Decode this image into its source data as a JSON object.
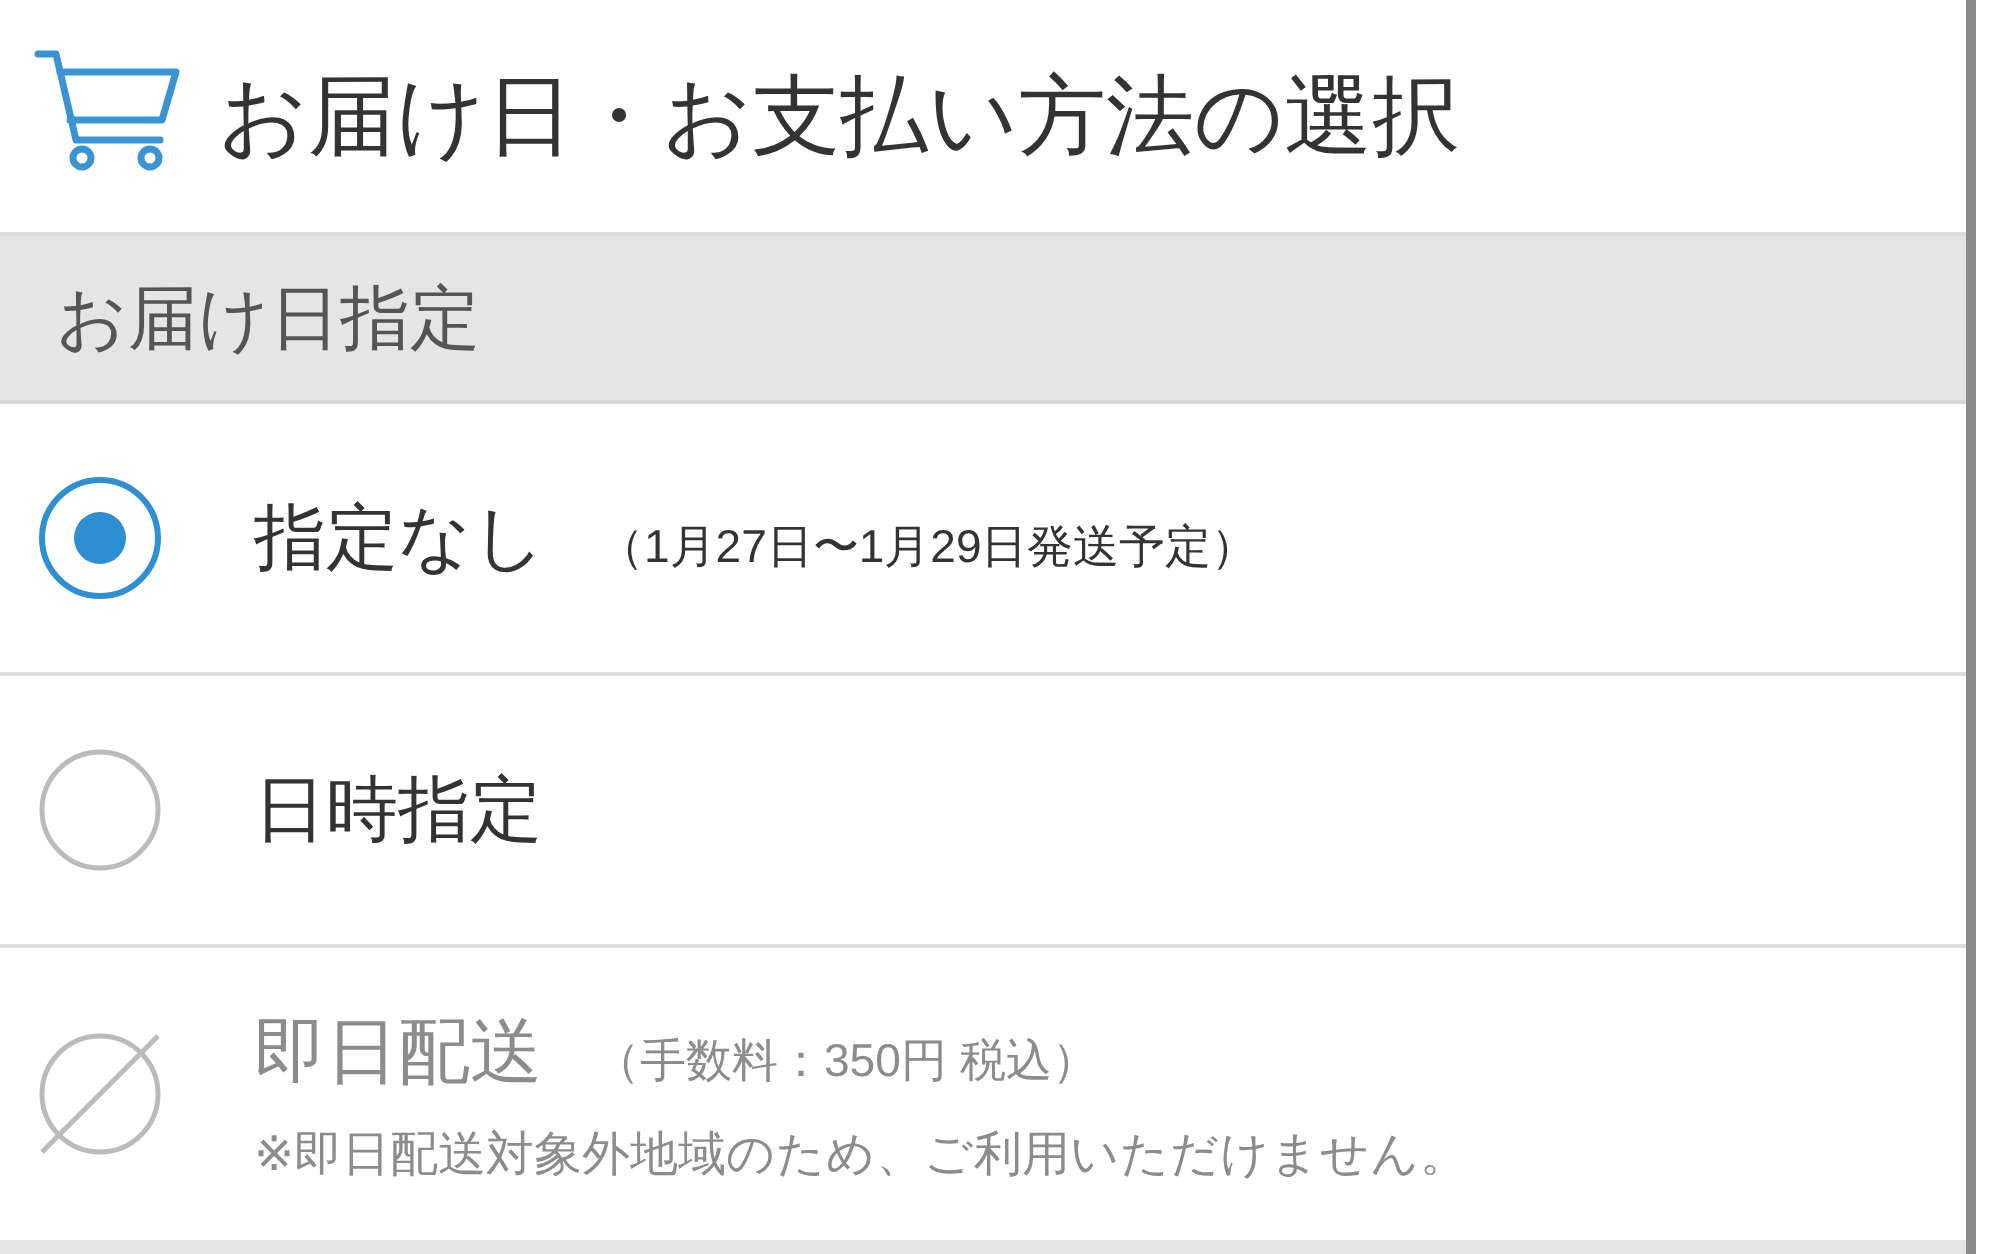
{
  "header": {
    "title": "お届け日・お支払い方法の選択"
  },
  "section": {
    "title": "お届け日指定"
  },
  "options": [
    {
      "label": "指定なし",
      "note": "（1月27日〜1月29日発送予定）",
      "selected": true,
      "disabled": false
    },
    {
      "label": "日時指定",
      "selected": false,
      "disabled": false
    },
    {
      "label": "即日配送",
      "note": "（手数料：350円 税込）",
      "message": "※即日配送対象外地域のため、ご利用いただけません。",
      "selected": false,
      "disabled": true
    }
  ]
}
